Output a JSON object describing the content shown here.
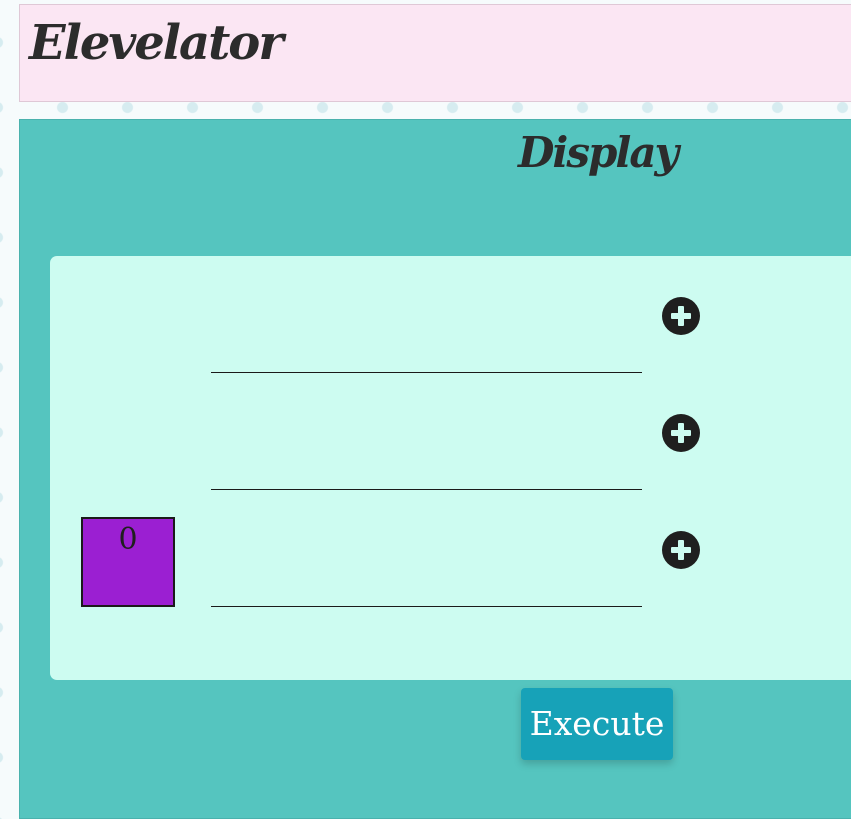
{
  "header": {
    "title": "Elevelator"
  },
  "display": {
    "title": "Display",
    "floors": [
      {
        "add_icon": "plus-circle-icon"
      },
      {
        "add_icon": "plus-circle-icon"
      },
      {
        "add_icon": "plus-circle-icon"
      }
    ],
    "elevator": {
      "current_floor": "0",
      "color": "#9b1fd2"
    }
  },
  "actions": {
    "execute_label": "Execute"
  },
  "colors": {
    "header_bg": "#fbe6f3",
    "panel_bg": "#55c5bf",
    "card_bg": "#cdfcf1",
    "button_bg": "#17a2b8"
  }
}
